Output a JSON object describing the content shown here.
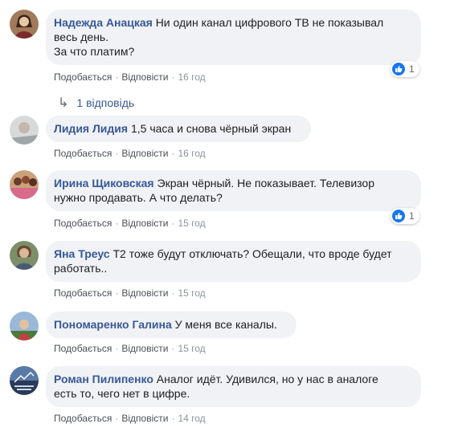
{
  "ui": {
    "like_label": "Подобається",
    "reply_label": "Відповісти",
    "separator": "·"
  },
  "comments": [
    {
      "author": "Надежда Анацкая",
      "text_lines": [
        "Ни один канал цифрового ТВ не показывал",
        "весь день.",
        "За что платим?"
      ],
      "time": "16 год",
      "reactions": "1",
      "replies_label": "1 відповідь"
    },
    {
      "author": "Лидия Лидия",
      "text_lines": [
        "1,5 часа и снова чёрный экран"
      ],
      "time": "16 год"
    },
    {
      "author": "Ирина Щиковская",
      "text_lines": [
        "Экран чёрный. Не показывает. Телевизор",
        "нужно продавать. А что делать?"
      ],
      "time": "15 год",
      "reactions": "1"
    },
    {
      "author": "Яна Треус",
      "text_lines": [
        "Т2 тоже будут отключать? Обещали, что вроде будет",
        "работать.."
      ],
      "time": "15 год"
    },
    {
      "author": "Пономаренко Галина",
      "text_lines": [
        "У меня все каналы."
      ],
      "time": "15 год"
    },
    {
      "author": "Роман Пилипенко",
      "text_lines": [
        "Аналог идёт. Удивился, но у нас в аналоге",
        "есть то, чего нет в цифре."
      ],
      "time": "14 год"
    }
  ],
  "icons": {
    "like": "thumbs-up-icon",
    "reply_arrow": "reply-arrow-icon"
  },
  "colors": {
    "author": "#385898",
    "bubble": "#f0f2f5",
    "like": "#1877f2"
  }
}
